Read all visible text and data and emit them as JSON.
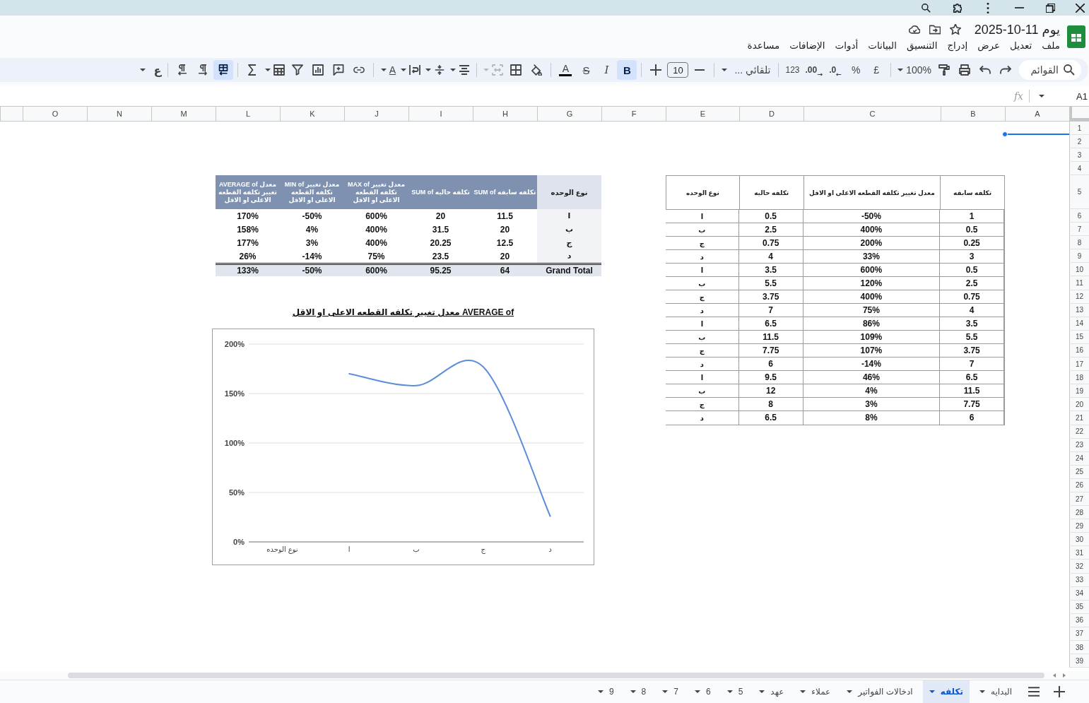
{
  "document": {
    "title": "يوم 11-10-2025"
  },
  "menu": [
    "ملف",
    "تعديل",
    "عرض",
    "إدراج",
    "التنسيق",
    "البيانات",
    "أدوات",
    "الإضافات",
    "مساعدة"
  ],
  "toolbar": {
    "search": {
      "placeholder": "القوائم"
    },
    "zoom": "100%",
    "currency": "£",
    "percent": "%",
    "decrease_decimals": ".0",
    "increase_decimals": ".00",
    "number_format": "123",
    "font": "تلقائي ...",
    "font_size": "10",
    "bold": {
      "label": "B",
      "on": true
    },
    "italic": {
      "label": "I",
      "on": false
    },
    "strikethrough": {
      "label": "S",
      "on": false
    },
    "text_color": "A",
    "merge": {
      "disabled": true
    },
    "text_rotation": "A",
    "sheet_rtl": {
      "on": true
    },
    "input_tools": "ع"
  },
  "formula_bar": {
    "name_box": "A1",
    "function_label": "fx"
  },
  "column_headers": [
    "A",
    "B",
    "C",
    "D",
    "E",
    "F",
    "G",
    "H",
    "I",
    "J",
    "K",
    "L",
    "M",
    "N",
    "O"
  ],
  "row_headers": [
    "1",
    "2",
    "3",
    "4",
    "5",
    "6",
    "7",
    "8",
    "9",
    "10",
    "11",
    "12",
    "13",
    "14",
    "15",
    "16",
    "17",
    "18",
    "19",
    "20",
    "21",
    "22",
    "23",
    "24",
    "25",
    "26",
    "27",
    "28",
    "29",
    "30",
    "31",
    "32",
    "33",
    "34",
    "35",
    "36",
    "37",
    "38",
    "39"
  ],
  "source_table": {
    "columns": [
      "تكلفه سابقه",
      "معدل تغيير تكلفه القطعه الاعلى او الاقل",
      "تكلفه حاليه",
      "نوع الوحده"
    ],
    "rows": [
      [
        "1",
        "-50%",
        "0.5",
        "ا"
      ],
      [
        "0.5",
        "400%",
        "2.5",
        "ب"
      ],
      [
        "0.25",
        "200%",
        "0.75",
        "ج"
      ],
      [
        "3",
        "33%",
        "4",
        "د"
      ],
      [
        "0.5",
        "600%",
        "3.5",
        "ا"
      ],
      [
        "2.5",
        "120%",
        "5.5",
        "ب"
      ],
      [
        "0.75",
        "400%",
        "3.75",
        "ج"
      ],
      [
        "4",
        "75%",
        "7",
        "د"
      ],
      [
        "3.5",
        "86%",
        "6.5",
        "ا"
      ],
      [
        "5.5",
        "109%",
        "11.5",
        "ب"
      ],
      [
        "3.75",
        "107%",
        "7.75",
        "ج"
      ],
      [
        "7",
        "-14%",
        "6",
        "د"
      ],
      [
        "6.5",
        "46%",
        "9.5",
        "ا"
      ],
      [
        "11.5",
        "4%",
        "12",
        "ب"
      ],
      [
        "7.75",
        "3%",
        "8",
        "ج"
      ],
      [
        "6",
        "8%",
        "6.5",
        "د"
      ]
    ]
  },
  "pivot_table": {
    "columns": [
      "نوع الوحده",
      "SUM of تكلفه سابقه",
      "SUM of تكلفه حاليه",
      "MAX of معدل تغيير تكلفه القطعه الاعلى او الاقل",
      "MIN of معدل تغيير تكلفه القطعه الاعلى او الاقل",
      "AVERAGE of معدل تغيير تكلفه القطعه الاعلى او الاقل"
    ],
    "rows": [
      [
        "ا",
        "11.5",
        "20",
        "600%",
        "-50%",
        "170%"
      ],
      [
        "ب",
        "20",
        "31.5",
        "400%",
        "4%",
        "158%"
      ],
      [
        "ج",
        "12.5",
        "20.25",
        "400%",
        "3%",
        "177%"
      ],
      [
        "د",
        "20",
        "23.5",
        "75%",
        "-14%",
        "26%"
      ]
    ],
    "total": [
      "Grand Total",
      "64",
      "95.25",
      "600%",
      "-50%",
      "133%"
    ]
  },
  "chart": {
    "chart_data": [
      {
        "type": "line",
        "title": "AVERAGE of معدل تغيير تكلفه القطعه الاعلى او الاقل",
        "categories": [
          "نوع الوحده",
          "ا",
          "ب",
          "ج",
          "د"
        ],
        "values": [
          null,
          170,
          158,
          177,
          26
        ],
        "color": "#5b8ddb",
        "yticks": [
          {
            "value": 0,
            "label": "0%"
          },
          {
            "value": 50,
            "label": "50%"
          },
          {
            "value": 100,
            "label": "100%"
          },
          {
            "value": 150,
            "label": "150%"
          },
          {
            "value": 200,
            "label": "200%"
          }
        ],
        "ylim": [
          0,
          200
        ],
        "grid": true
      }
    ]
  },
  "sheet_tabs": [
    {
      "label": "البدايه",
      "selected": false
    },
    {
      "label": "تكلفه",
      "selected": true
    },
    {
      "label": "ادخالات الفواتير",
      "selected": false
    },
    {
      "label": "عملاء",
      "selected": false
    },
    {
      "label": "عهد",
      "selected": false
    },
    {
      "label": "5",
      "selected": false
    },
    {
      "label": "6",
      "selected": false
    },
    {
      "label": "7",
      "selected": false
    },
    {
      "label": "8",
      "selected": false
    },
    {
      "label": "9",
      "selected": false
    }
  ]
}
